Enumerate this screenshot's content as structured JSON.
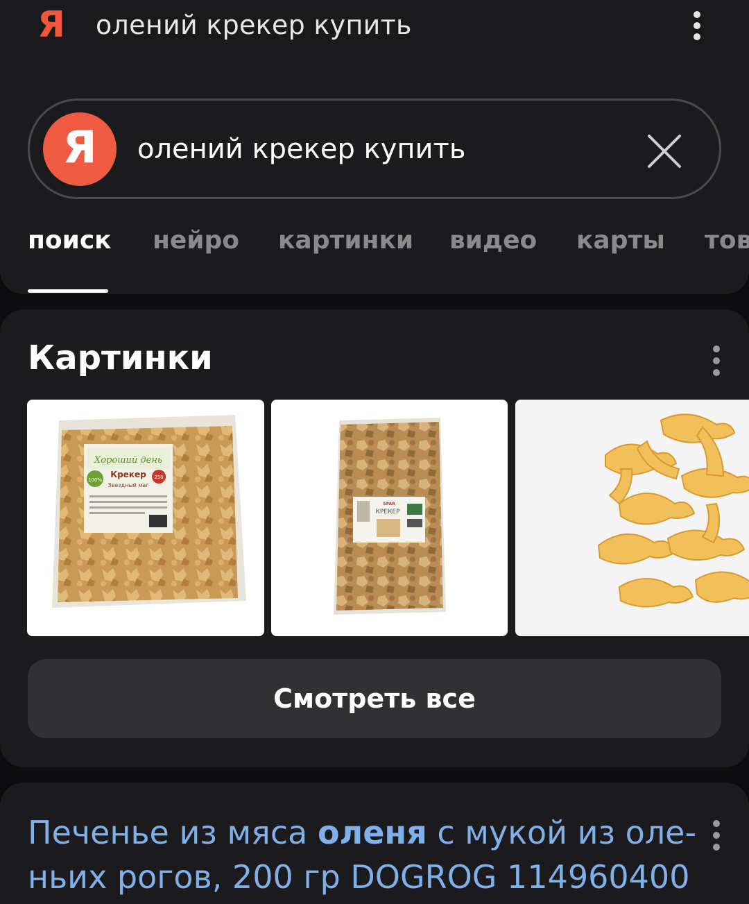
{
  "topbar": {
    "logo": "Я",
    "query": "олений крекер купить",
    "menu_icon": "more-vertical-icon"
  },
  "search": {
    "logo": "Я",
    "value": "олений крекер купить",
    "clear_icon": "close-icon"
  },
  "tabs": [
    {
      "label": "поиск",
      "active": true
    },
    {
      "label": "нейро",
      "active": false
    },
    {
      "label": "картинки",
      "active": false
    },
    {
      "label": "видео",
      "active": false
    },
    {
      "label": "карты",
      "active": false
    },
    {
      "label": "тов",
      "active": false
    }
  ],
  "images_section": {
    "title": "Картинки",
    "images": [
      {
        "label_brand": "Хороший день",
        "label_title": "Крекер",
        "label_sub": "Звездный маг",
        "badge": "250",
        "pct": "100%"
      },
      {
        "label_title": "КРЕКЕР",
        "label_brand": "SPAR"
      },
      {}
    ],
    "see_all_label": "Смотреть все"
  },
  "result": {
    "title_parts": [
      {
        "text": "Печенье из мяса ",
        "bold": false
      },
      {
        "text": "оленя",
        "bold": true
      },
      {
        "text": " с мукой из оле-ньих рогов, 200 гр DOGROG 114960400",
        "bold": false
      }
    ]
  },
  "colors": {
    "accent_red": "#ef5b42",
    "link_blue": "#7fb0ea",
    "background": "#0d0d0f",
    "card": "#1b1b1d"
  }
}
